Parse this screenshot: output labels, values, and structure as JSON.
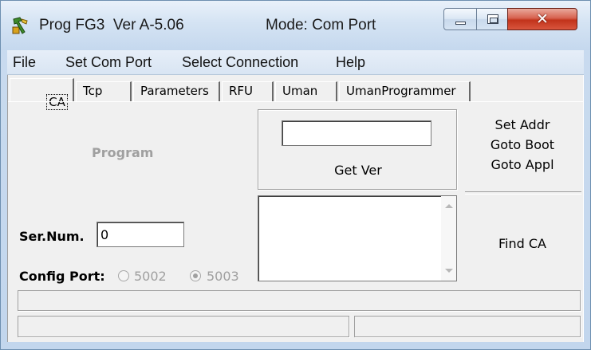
{
  "window": {
    "title": "Prog FG3  Ver A-5.06",
    "mode": "Mode: Com Port",
    "colors": {
      "titlebar": "#d4e3f3",
      "close_button": "#c2331b",
      "client_background": "#f0f0f0",
      "disabled_text": "#a0a0a0"
    }
  },
  "menu": {
    "items": [
      "File",
      "Set Com Port",
      "Select Connection",
      "Help"
    ]
  },
  "tabs": [
    {
      "label": "CA",
      "active": true
    },
    {
      "label": "Tcp",
      "active": false
    },
    {
      "label": "Parameters",
      "active": false
    },
    {
      "label": "RFU",
      "active": false
    },
    {
      "label": "Uman",
      "active": false
    },
    {
      "label": "UmanProgrammer",
      "active": false
    }
  ],
  "ca_tab": {
    "program_label": "Program",
    "ver_input_value": "",
    "get_ver_label": "Get Ver",
    "set_addr_label": "Set Addr",
    "goto_boot_label": "Goto Boot",
    "goto_appl_label": "Goto Appl",
    "find_ca_label": "Find CA",
    "ser_num_label": "Ser.Num.",
    "ser_num_value": "0",
    "config_port_label": "Config Port:",
    "port_options": [
      {
        "label": "5002",
        "checked": false
      },
      {
        "label": "5003",
        "checked": true
      }
    ]
  },
  "status": {
    "line1": "",
    "left": "",
    "right": ""
  },
  "icons": {
    "app": "hammer-app-icon",
    "minimize": "minimize-icon",
    "maximize": "maximize-icon",
    "close": "close-icon"
  }
}
